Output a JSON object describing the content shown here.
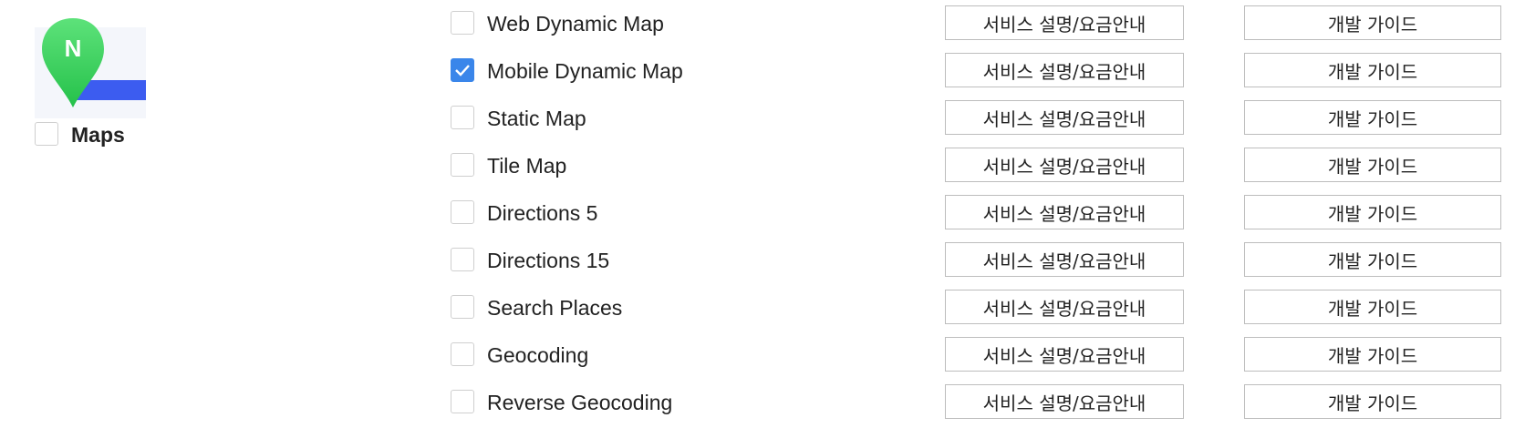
{
  "product": {
    "logo_icon": "naver-maps-pin-icon",
    "logo_letter": "N",
    "name": "Maps",
    "checked": false,
    "colors": {
      "pin_top": "#5de27a",
      "pin_bottom": "#25c14a",
      "stripe": "#3c5cf0"
    }
  },
  "services": [
    {
      "label": "Web Dynamic Map",
      "checked": false,
      "service_button": "서비스 설명/요금안내",
      "guide_button": "개발 가이드"
    },
    {
      "label": "Mobile Dynamic Map",
      "checked": true,
      "service_button": "서비스 설명/요금안내",
      "guide_button": "개발 가이드"
    },
    {
      "label": "Static Map",
      "checked": false,
      "service_button": "서비스 설명/요금안내",
      "guide_button": "개발 가이드"
    },
    {
      "label": "Tile Map",
      "checked": false,
      "service_button": "서비스 설명/요금안내",
      "guide_button": "개발 가이드"
    },
    {
      "label": "Directions 5",
      "checked": false,
      "service_button": "서비스 설명/요금안내",
      "guide_button": "개발 가이드"
    },
    {
      "label": "Directions 15",
      "checked": false,
      "service_button": "서비스 설명/요금안내",
      "guide_button": "개발 가이드"
    },
    {
      "label": "Search Places",
      "checked": false,
      "service_button": "서비스 설명/요금안내",
      "guide_button": "개발 가이드"
    },
    {
      "label": "Geocoding",
      "checked": false,
      "service_button": "서비스 설명/요금안내",
      "guide_button": "개발 가이드"
    },
    {
      "label": "Reverse Geocoding",
      "checked": false,
      "service_button": "서비스 설명/요금안내",
      "guide_button": "개발 가이드"
    }
  ],
  "colors": {
    "check_accent": "#3a86ea",
    "border": "#cfcfcf",
    "button_border": "#bdbdbd"
  }
}
